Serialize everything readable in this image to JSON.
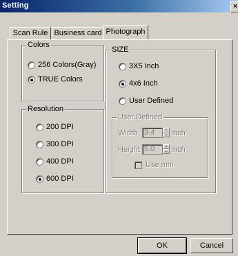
{
  "window": {
    "title": "Setting",
    "close_glyph": "×"
  },
  "tabs": [
    {
      "label": "Scan Rule",
      "active": false
    },
    {
      "label": "Business card",
      "active": false
    },
    {
      "label": "Photograph",
      "active": true
    }
  ],
  "colors_group": {
    "label": "Colors",
    "options": [
      {
        "label": "256 Colors(Gray)",
        "selected": false
      },
      {
        "label": "TRUE Colors",
        "selected": true
      }
    ]
  },
  "resolution_group": {
    "label": "Resolution",
    "options": [
      {
        "label": "200 DPI",
        "selected": false
      },
      {
        "label": "300 DPI",
        "selected": false
      },
      {
        "label": "400 DPI",
        "selected": false
      },
      {
        "label": "600 DPI",
        "selected": true
      }
    ]
  },
  "size_group": {
    "label": "SIZE",
    "options": [
      {
        "label": "3X5 Inch",
        "selected": false
      },
      {
        "label": "4x6 Inch",
        "selected": true
      },
      {
        "label": "User Defined",
        "selected": false
      }
    ],
    "user_defined": {
      "label": "User Defined",
      "width_label": "Width",
      "width_value": "3.4",
      "height_label": "Height",
      "height_value": "5.0",
      "unit": "Inch",
      "use_mm_label": "Use mm",
      "use_mm_checked": false,
      "enabled": false
    }
  },
  "buttons": {
    "ok": "OK",
    "cancel": "Cancel"
  }
}
